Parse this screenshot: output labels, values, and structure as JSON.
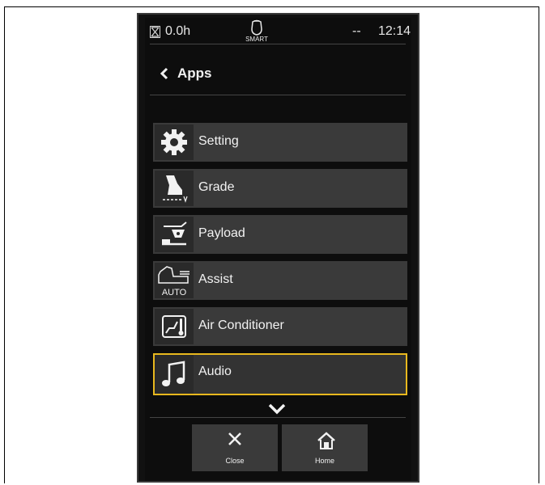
{
  "status_bar": {
    "hours": "0.0h",
    "smart_label": "SMART",
    "indicator": "--",
    "time": "12:14",
    "hour_meter_icon": "hourglass-icon",
    "smart_icon": "engine-smart-icon"
  },
  "header": {
    "title": "Apps",
    "back_icon": "chevron-left-icon"
  },
  "apps": [
    {
      "label": "Setting",
      "icon": "gear-icon"
    },
    {
      "label": "Grade",
      "icon": "grade-bucket-icon"
    },
    {
      "label": "Payload",
      "icon": "payload-scale-icon"
    },
    {
      "label": "Assist",
      "icon": "excavator-auto-icon",
      "icon_text": "AUTO"
    },
    {
      "label": "Air Conditioner",
      "icon": "climate-icon"
    },
    {
      "label": "Audio",
      "icon": "music-note-icon",
      "selected": true
    }
  ],
  "scroll": {
    "icon": "chevron-down-icon"
  },
  "footer": {
    "close_label": "Close",
    "home_label": "Home",
    "close_icon": "close-icon",
    "home_icon": "home-icon"
  },
  "colors": {
    "screen_bg": "#0d0d0d",
    "item_bg": "#3a3a3a",
    "selection": "#e8b81e",
    "text": "#f2f2f2"
  }
}
